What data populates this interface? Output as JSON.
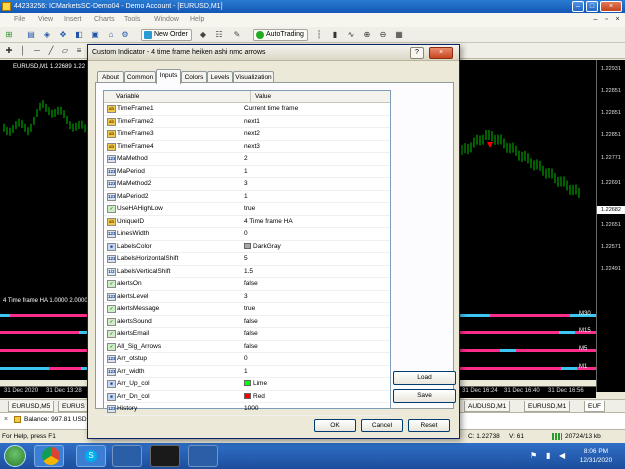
{
  "window": {
    "title": "44233256: ICMarketsSC-Demo04 - Demo Account - [EURUSD,M1]"
  },
  "menu": [
    "File",
    "View",
    "Insert",
    "Charts",
    "Tools",
    "Window",
    "Help"
  ],
  "toolbar": {
    "new_order": "New Order",
    "autotrading": "AutoTrading",
    "timeframes": [
      "M1",
      "M5",
      "M15",
      "M30",
      "H1",
      "H4",
      "D1",
      "W1",
      "MN"
    ]
  },
  "chart": {
    "symbol_label": "EURUSD,M1  1.22689 1.22",
    "subwindow_label": "4 Time frame HA 1.0000 2.0000",
    "current_price": "1.22682",
    "price_ticks": [
      "1.22931",
      "1.22851",
      "1.22771",
      "1.22691",
      "1.22651",
      "1.22571",
      "1.22491",
      "1.22411"
    ],
    "stripe_labels": [
      "M30",
      "M15",
      "M5",
      "M1"
    ],
    "time_ticks": [
      "31 Dec 2020",
      "31 Dec 13:28",
      "31 Dec 16:24",
      "31 Dec 16:40",
      "31 Dec 16:56"
    ],
    "tabs": [
      "EURUSD,M5",
      "EURUS",
      "AUDUSD,M1",
      "EURUSD,M1",
      "EUF"
    ]
  },
  "statusbar": {
    "help": "For Help, press F1",
    "balance": "Balance: 997.81 USD",
    "close": "C: 1.22738",
    "volume": "V: 61",
    "traffic": "20724/13 kb"
  },
  "clock": {
    "time": "8:06 PM",
    "date": "12/31/2020"
  },
  "dialog": {
    "title": "Custom Indicator - 4 time frame heiken ashi nmc arrows",
    "help_btn": "?",
    "close_btn": "×",
    "tabs": [
      "About",
      "Common",
      "Inputs",
      "Colors",
      "Levels",
      "Visualization"
    ],
    "active_tab": "Inputs",
    "columns": [
      "Variable",
      "Value"
    ],
    "rows": [
      {
        "type": "ab",
        "name": "TimeFrame1",
        "value": "Current time frame"
      },
      {
        "type": "ab",
        "name": "TimeFrame2",
        "value": "next1"
      },
      {
        "type": "ab",
        "name": "TimeFrame3",
        "value": "next2"
      },
      {
        "type": "ab",
        "name": "TimeFrame4",
        "value": "next3"
      },
      {
        "type": "123",
        "name": "MaMethod",
        "value": "2"
      },
      {
        "type": "123",
        "name": "MaPeriod",
        "value": "1"
      },
      {
        "type": "123",
        "name": "MaMethod2",
        "value": "3"
      },
      {
        "type": "123",
        "name": "MaPeriod2",
        "value": "1"
      },
      {
        "type": "bool",
        "name": "UseHAHighLow",
        "value": "true"
      },
      {
        "type": "ab",
        "name": "UniqueID",
        "value": "4 Time frame HA"
      },
      {
        "type": "123",
        "name": "LinesWidth",
        "value": "0"
      },
      {
        "type": "color",
        "name": "LabelsColor",
        "value": "DarkGray",
        "swatch": "#a9a9a9"
      },
      {
        "type": "123",
        "name": "LabelsHorizontalShift",
        "value": "5"
      },
      {
        "type": "dbl",
        "name": "LabelsVerticalShift",
        "value": "1.5"
      },
      {
        "type": "bool",
        "name": "alertsOn",
        "value": "false"
      },
      {
        "type": "123",
        "name": "alertsLevel",
        "value": "3"
      },
      {
        "type": "bool",
        "name": "alertsMessage",
        "value": "true"
      },
      {
        "type": "bool",
        "name": "alertsSound",
        "value": "false"
      },
      {
        "type": "bool",
        "name": "alertsEmail",
        "value": "false"
      },
      {
        "type": "bool",
        "name": "All_Sig_Arrows",
        "value": "false"
      },
      {
        "type": "123",
        "name": "Arr_otstup",
        "value": "0"
      },
      {
        "type": "123",
        "name": "Arr_width",
        "value": "1"
      },
      {
        "type": "color",
        "name": "Arr_Up_col",
        "value": "Lime",
        "swatch": "#00ff00"
      },
      {
        "type": "color",
        "name": "Arr_Dn_col",
        "value": "Red",
        "swatch": "#ff0000"
      },
      {
        "type": "123",
        "name": "History",
        "value": "1000"
      }
    ],
    "load_btn": "Load",
    "save_btn": "Save",
    "ok_btn": "OK",
    "cancel_btn": "Cancel",
    "reset_btn": "Reset"
  },
  "colors": {
    "stripe_pink": "#ff2d8a",
    "stripe_cyan": "#3ec6f2",
    "candles": "#00c000"
  }
}
